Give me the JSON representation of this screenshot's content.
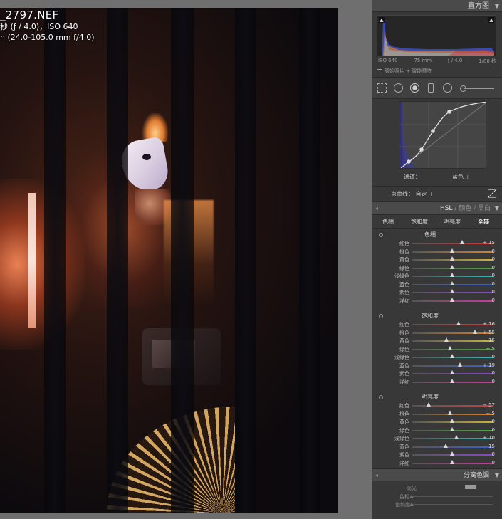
{
  "photo": {
    "filename": "_2797.NEF",
    "exposure_line": "秒 (ƒ / 4.0)，ISO 640",
    "lens_line": "n (24.0-105.0 mm f/4.0)"
  },
  "histogram": {
    "title": "直方图",
    "iso": "ISO 640",
    "focal": "75 mm",
    "aperture": "ƒ / 4.0",
    "shutter": "1/80 秒",
    "original_photo": "原始照片 + 智能预览"
  },
  "curve": {
    "channel_label": "通道：",
    "channel_value": "蓝色 ÷",
    "point_curve_label": "点曲线：",
    "point_curve_value": "自定 ÷"
  },
  "hsl": {
    "items": [
      "HSL",
      "颜色",
      "黑白"
    ],
    "separator": " / ",
    "tabs": [
      "色相",
      "饱和度",
      "明亮度",
      "全部"
    ],
    "groups": [
      {
        "title": "色相",
        "rows": [
          {
            "label": "红色",
            "value": "+ 15",
            "pos": 0.62
          },
          {
            "label": "橙色",
            "value": "0",
            "pos": 0.5
          },
          {
            "label": "黄色",
            "value": "0",
            "pos": 0.5
          },
          {
            "label": "绿色",
            "value": "0",
            "pos": 0.5
          },
          {
            "label": "浅绿色",
            "value": "0",
            "pos": 0.5
          },
          {
            "label": "蓝色",
            "value": "0",
            "pos": 0.5
          },
          {
            "label": "紫色",
            "value": "0",
            "pos": 0.5
          },
          {
            "label": "洋红",
            "value": "0",
            "pos": 0.5
          }
        ]
      },
      {
        "title": "饱和度",
        "rows": [
          {
            "label": "红色",
            "value": "+ 16",
            "pos": 0.58
          },
          {
            "label": "橙色",
            "value": "+ 55",
            "pos": 0.78
          },
          {
            "label": "黄色",
            "value": "− 15",
            "pos": 0.43
          },
          {
            "label": "绿色",
            "value": "− 5",
            "pos": 0.47
          },
          {
            "label": "浅绿色",
            "value": "0",
            "pos": 0.5
          },
          {
            "label": "蓝色",
            "value": "+ 19",
            "pos": 0.6
          },
          {
            "label": "紫色",
            "value": "0",
            "pos": 0.5
          },
          {
            "label": "洋红",
            "value": "0",
            "pos": 0.5
          }
        ]
      },
      {
        "title": "明亮度",
        "rows": [
          {
            "label": "红色",
            "value": "− 57",
            "pos": 0.21
          },
          {
            "label": "橙色",
            "value": "− 5",
            "pos": 0.47
          },
          {
            "label": "黄色",
            "value": "0",
            "pos": 0.5
          },
          {
            "label": "绿色",
            "value": "0",
            "pos": 0.5
          },
          {
            "label": "浅绿色",
            "value": "+ 10",
            "pos": 0.55
          },
          {
            "label": "蓝色",
            "value": "− 15",
            "pos": 0.42
          },
          {
            "label": "紫色",
            "value": "0",
            "pos": 0.5
          },
          {
            "label": "洋红",
            "value": "0",
            "pos": 0.5
          }
        ]
      }
    ]
  },
  "split_toning": {
    "title": "分离色调",
    "highlights": "高光",
    "hue": "色相",
    "saturation": "饱和度"
  },
  "colors": {
    "red": "#d23c3c",
    "orange": "#d9822b",
    "yellow": "#c8b43a",
    "green": "#4caa3c",
    "aqua": "#3cb4b4",
    "blue": "#3a5fd0",
    "purple": "#8a46c8",
    "magenta": "#c83c9e"
  }
}
